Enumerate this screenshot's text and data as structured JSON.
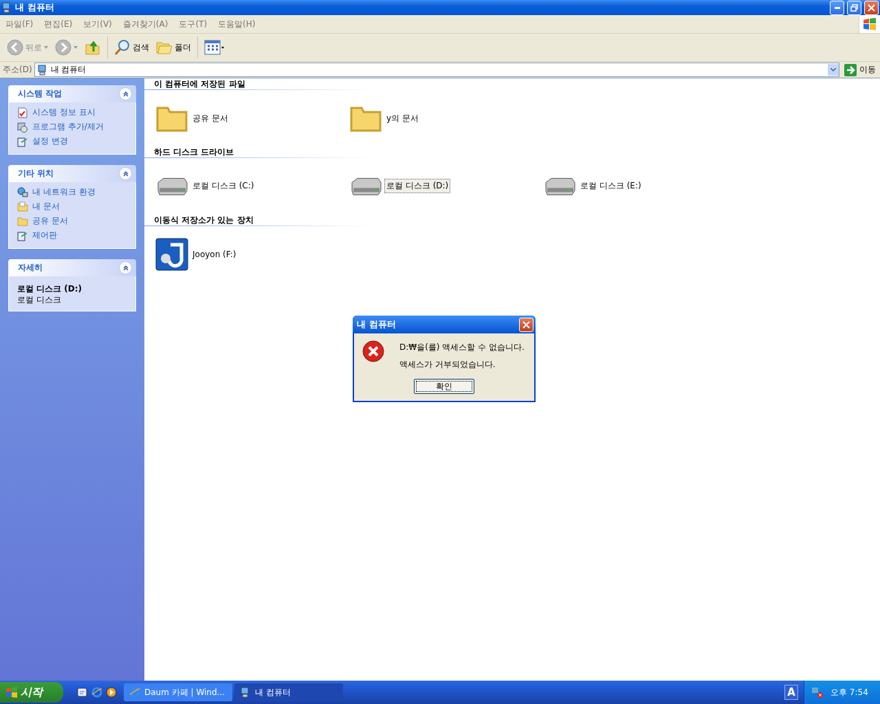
{
  "window": {
    "title": "내 컴퓨터"
  },
  "menu": [
    "파일(F)",
    "편집(E)",
    "보기(V)",
    "즐겨찾기(A)",
    "도구(T)",
    "도움말(H)"
  ],
  "toolbar": [
    {
      "kind": "back",
      "label": "뒤로",
      "disabled": true
    },
    {
      "kind": "forward",
      "disabled": true
    },
    {
      "kind": "up"
    },
    {
      "kind": "search",
      "label": "검색"
    },
    {
      "kind": "folders",
      "label": "폴더"
    },
    {
      "kind": "views"
    }
  ],
  "address": {
    "label": "주소(D)",
    "value": "내 컴퓨터",
    "go": "이동"
  },
  "side_panels": [
    {
      "kind": "links",
      "title": "시스템 작업",
      "items": [
        {
          "label": "시스템 정보 표시",
          "kind": "info"
        },
        {
          "label": "프로그램 추가/제거",
          "kind": "programs"
        },
        {
          "label": "설정 변경",
          "kind": "control"
        }
      ]
    },
    {
      "kind": "links",
      "title": "기타 위치",
      "items": [
        {
          "label": "내 네트워크 환경",
          "kind": "network"
        },
        {
          "label": "내 문서",
          "kind": "documents"
        },
        {
          "label": "공유 문서",
          "kind": "folder"
        },
        {
          "label": "제어판",
          "kind": "control"
        }
      ]
    },
    {
      "kind": "details",
      "title": "자세히",
      "name": "로컬 디스크 (D:)",
      "type": "로컬 디스크"
    }
  ],
  "sections": [
    {
      "title": "이 컴퓨터에 저장된 파일",
      "items": [
        {
          "label": "공유 문서",
          "kind": "folder",
          "selected": false
        },
        {
          "label": "y의 문서",
          "kind": "folder",
          "selected": false
        }
      ]
    },
    {
      "title": "하드 디스크 드라이브",
      "items": [
        {
          "label": "로컬 디스크 (C:)",
          "kind": "drive",
          "selected": false
        },
        {
          "label": "로컬 디스크 (D:)",
          "kind": "drive",
          "selected": true
        },
        {
          "label": "로컬 디스크 (E:)",
          "kind": "drive",
          "selected": false
        }
      ]
    },
    {
      "title": "이동식 저장소가 있는 장치",
      "items": [
        {
          "label": "Jooyon (F:)",
          "kind": "removable",
          "selected": false
        }
      ]
    }
  ],
  "dialog": {
    "title": "내 컴퓨터",
    "lines": [
      "D:₩을(를) 액세스할 수 없습니다.",
      "액세스가 거부되었습니다."
    ],
    "button": "확인"
  },
  "taskbar": {
    "start": "시작",
    "tasks": [
      {
        "label": "Daum 카페 | Wind...",
        "kind": "browser",
        "selected": false
      },
      {
        "label": "내 컴퓨터",
        "kind": "computer",
        "selected": true
      }
    ],
    "ime": "A",
    "clock": "오후 7:54"
  }
}
